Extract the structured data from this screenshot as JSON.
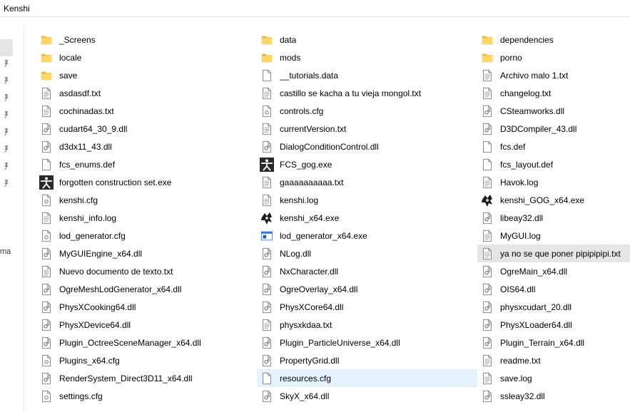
{
  "window": {
    "title": "Kenshi"
  },
  "navpane": {
    "cut_label": "ma"
  },
  "files": [
    {
      "name": "_Screens",
      "icon": "folder-icon"
    },
    {
      "name": "locale",
      "icon": "folder-icon"
    },
    {
      "name": "save",
      "icon": "folder-icon"
    },
    {
      "name": "asdasdf.txt",
      "icon": "text-file-icon"
    },
    {
      "name": "cochinadas.txt",
      "icon": "text-file-icon"
    },
    {
      "name": "cudart64_30_9.dll",
      "icon": "dll-file-icon"
    },
    {
      "name": "d3dx11_43.dll",
      "icon": "dll-file-icon"
    },
    {
      "name": "fcs_enums.def",
      "icon": "blank-file-icon"
    },
    {
      "name": "forgotten construction set.exe",
      "icon": "fcs-app-icon"
    },
    {
      "name": "kenshi.cfg",
      "icon": "config-file-icon"
    },
    {
      "name": "kenshi_info.log",
      "icon": "text-file-icon"
    },
    {
      "name": "lod_generator.cfg",
      "icon": "config-file-icon"
    },
    {
      "name": "MyGUIEngine_x64.dll",
      "icon": "dll-file-icon"
    },
    {
      "name": "Nuevo documento de texto.txt",
      "icon": "text-file-icon"
    },
    {
      "name": "OgreMeshLodGenerator_x64.dll",
      "icon": "dll-file-icon"
    },
    {
      "name": "PhysXCooking64.dll",
      "icon": "dll-file-icon"
    },
    {
      "name": "PhysXDevice64.dll",
      "icon": "dll-file-icon"
    },
    {
      "name": "Plugin_OctreeSceneManager_x64.dll",
      "icon": "dll-file-icon"
    },
    {
      "name": "Plugins_x64.cfg",
      "icon": "config-file-icon"
    },
    {
      "name": "RenderSystem_Direct3D11_x64.dll",
      "icon": "dll-file-icon"
    },
    {
      "name": "settings.cfg",
      "icon": "config-file-icon"
    },
    {
      "name": "data",
      "icon": "folder-icon"
    },
    {
      "name": "mods",
      "icon": "folder-icon"
    },
    {
      "name": "__tutorials.data",
      "icon": "blank-file-icon"
    },
    {
      "name": "castillo se kacha a tu vieja mongol.txt",
      "icon": "text-file-icon"
    },
    {
      "name": "controls.cfg",
      "icon": "config-file-icon"
    },
    {
      "name": "currentVersion.txt",
      "icon": "text-file-icon"
    },
    {
      "name": "DialogConditionControl.dll",
      "icon": "dll-file-icon"
    },
    {
      "name": "FCS_gog.exe",
      "icon": "fcs-app-icon"
    },
    {
      "name": "gaaaaaaaaaa.txt",
      "icon": "text-file-icon"
    },
    {
      "name": "kenshi.log",
      "icon": "text-file-icon"
    },
    {
      "name": "kenshi_x64.exe",
      "icon": "kenshi-app-icon"
    },
    {
      "name": "lod_generator_x64.exe",
      "icon": "exe-window-icon"
    },
    {
      "name": "NLog.dll",
      "icon": "dll-file-icon"
    },
    {
      "name": "NxCharacter.dll",
      "icon": "dll-file-icon"
    },
    {
      "name": "OgreOverlay_x64.dll",
      "icon": "dll-file-icon"
    },
    {
      "name": "PhysXCore64.dll",
      "icon": "dll-file-icon"
    },
    {
      "name": "physxkdaa.txt",
      "icon": "text-file-icon"
    },
    {
      "name": "Plugin_ParticleUniverse_x64.dll",
      "icon": "dll-file-icon"
    },
    {
      "name": "PropertyGrid.dll",
      "icon": "dll-file-icon"
    },
    {
      "name": "resources.cfg",
      "icon": "blank-file-icon",
      "state": "hover"
    },
    {
      "name": "SkyX_x64.dll",
      "icon": "dll-file-icon"
    },
    {
      "name": "dependencies",
      "icon": "folder-icon"
    },
    {
      "name": "porno",
      "icon": "folder-icon"
    },
    {
      "name": "Archivo malo 1.txt",
      "icon": "text-file-icon"
    },
    {
      "name": "changelog.txt",
      "icon": "text-file-icon"
    },
    {
      "name": "CSteamworks.dll",
      "icon": "dll-file-icon"
    },
    {
      "name": "D3DCompiler_43.dll",
      "icon": "dll-file-icon"
    },
    {
      "name": "fcs.def",
      "icon": "blank-file-icon"
    },
    {
      "name": "fcs_layout.def",
      "icon": "blank-file-icon"
    },
    {
      "name": "Havok.log",
      "icon": "text-file-icon"
    },
    {
      "name": "kenshi_GOG_x64.exe",
      "icon": "kenshi-app-icon"
    },
    {
      "name": "libeay32.dll",
      "icon": "dll-file-icon"
    },
    {
      "name": "MyGUI.log",
      "icon": "text-file-icon"
    },
    {
      "name": "ya no se que poner pipipipipi.txt",
      "icon": "text-file-icon",
      "state": "selected"
    },
    {
      "name": "OgreMain_x64.dll",
      "icon": "dll-file-icon"
    },
    {
      "name": "OIS64.dll",
      "icon": "dll-file-icon"
    },
    {
      "name": "physxcudart_20.dll",
      "icon": "dll-file-icon"
    },
    {
      "name": "PhysXLoader64.dll",
      "icon": "dll-file-icon"
    },
    {
      "name": "Plugin_Terrain_x64.dll",
      "icon": "dll-file-icon"
    },
    {
      "name": "readme.txt",
      "icon": "text-file-icon"
    },
    {
      "name": "save.log",
      "icon": "text-file-icon"
    },
    {
      "name": "ssleay32.dll",
      "icon": "dll-file-icon"
    }
  ]
}
